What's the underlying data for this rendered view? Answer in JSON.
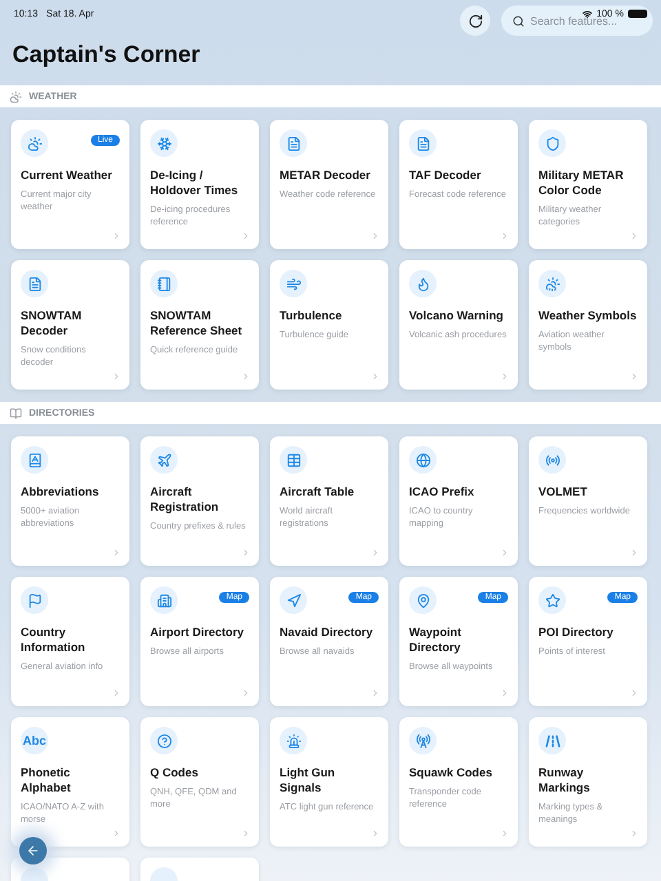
{
  "status_bar": {
    "time": "10:13",
    "date": "Sat 18. Apr",
    "battery": "100 %"
  },
  "search": {
    "placeholder": "Search features..."
  },
  "title": "Captain's Corner",
  "sections": [
    {
      "title": "WEATHER",
      "cards": [
        {
          "kind": "feature",
          "title": "Current Weather",
          "subtitle": "Current major city weather",
          "badge": "Live"
        },
        {
          "kind": "feature",
          "title": "De-Icing / Holdover Times",
          "subtitle": "De-icing procedures reference"
        },
        {
          "kind": "feature",
          "title": "METAR Decoder",
          "subtitle": "Weather code reference"
        },
        {
          "kind": "feature",
          "title": "TAF Decoder",
          "subtitle": "Forecast code reference"
        },
        {
          "kind": "feature",
          "title": "Military METAR Color Code",
          "subtitle": "Military weather categories"
        },
        {
          "kind": "feature",
          "title": "SNOWTAM Decoder",
          "subtitle": "Snow conditions decoder"
        },
        {
          "kind": "feature",
          "title": "SNOWTAM Reference Sheet",
          "subtitle": "Quick reference guide"
        },
        {
          "kind": "feature",
          "title": "Turbulence",
          "subtitle": "Turbulence guide"
        },
        {
          "kind": "feature",
          "title": "Volcano Warning",
          "subtitle": "Volcanic ash procedures"
        },
        {
          "kind": "feature",
          "title": "Weather Symbols",
          "subtitle": "Aviation weather symbols"
        }
      ]
    },
    {
      "title": "DIRECTORIES",
      "cards": [
        {
          "kind": "feature",
          "title": "Abbreviations",
          "subtitle": "5000+ aviation abbreviations"
        },
        {
          "kind": "feature",
          "title": "Aircraft Registration",
          "subtitle": "Country prefixes & rules"
        },
        {
          "kind": "feature",
          "title": "Aircraft Table",
          "subtitle": "World aircraft registrations"
        },
        {
          "kind": "feature",
          "title": "ICAO Prefix",
          "subtitle": "ICAO to country mapping"
        },
        {
          "kind": "feature",
          "title": "VOLMET",
          "subtitle": "Frequencies worldwide"
        },
        {
          "kind": "feature",
          "title": "Country Information",
          "subtitle": "General aviation info"
        },
        {
          "kind": "feature",
          "title": "Airport Directory",
          "subtitle": "Browse all airports",
          "badge": "Map"
        },
        {
          "kind": "feature",
          "title": "Navaid Directory",
          "subtitle": "Browse all navaids",
          "badge": "Map"
        },
        {
          "kind": "feature",
          "title": "Waypoint Directory",
          "subtitle": "Browse all waypoints",
          "badge": "Map"
        },
        {
          "kind": "feature",
          "title": "POI Directory",
          "subtitle": "Points of interest",
          "badge": "Map"
        },
        {
          "kind": "feature",
          "title": "Phonetic Alphabet",
          "subtitle": "ICAO/NATO A-Z with morse",
          "icon_text": "Abc"
        },
        {
          "kind": "feature",
          "title": "Q Codes",
          "subtitle": "QNH, QFE, QDM and more"
        },
        {
          "kind": "feature",
          "title": "Light Gun Signals",
          "subtitle": "ATC light gun reference"
        },
        {
          "kind": "feature",
          "title": "Squawk Codes",
          "subtitle": "Transponder code reference"
        },
        {
          "kind": "feature",
          "title": "Runway Markings",
          "subtitle": "Marking types & meanings"
        },
        {
          "kind": "partial"
        },
        {
          "kind": "partial"
        }
      ]
    }
  ]
}
